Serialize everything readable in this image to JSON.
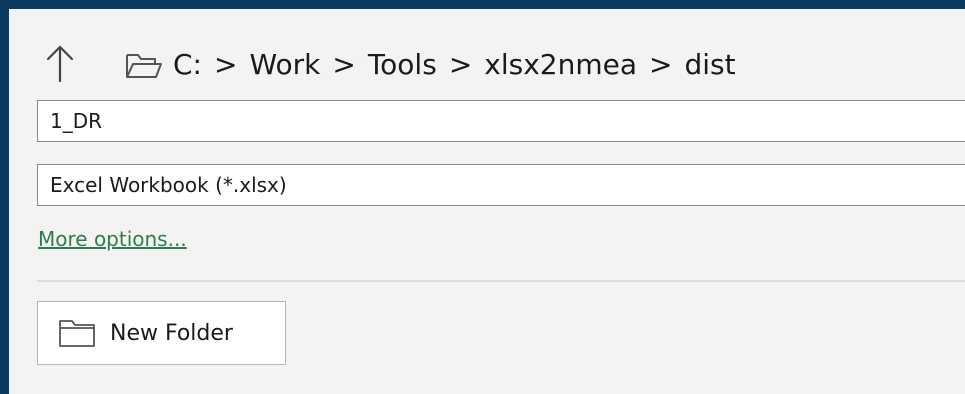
{
  "nav": {
    "up_icon": "arrow-up-icon",
    "folder_icon": "folder-open-icon",
    "path": [
      {
        "label": "C:"
      },
      {
        "label": "Work"
      },
      {
        "label": "Tools"
      },
      {
        "label": "xlsx2nmea"
      },
      {
        "label": "dist"
      }
    ],
    "separator": ">"
  },
  "file_name": {
    "value": "1_DR"
  },
  "file_type": {
    "value": "Excel Workbook (*.xlsx)"
  },
  "more_options": {
    "label": "More options..."
  },
  "new_folder": {
    "icon": "folder-icon",
    "label": "New Folder"
  },
  "colors": {
    "window_border": "#0e3a5e",
    "panel_bg": "#f3f3f3",
    "link": "#2e7d4f"
  }
}
